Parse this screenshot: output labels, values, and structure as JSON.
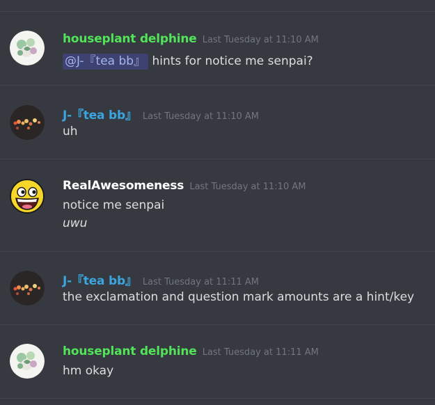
{
  "colors": {
    "background": "#36393f",
    "divider": "#42454a",
    "timestamp": "#72767d",
    "message_text": "#dcddde",
    "mention_bg": "#3e4270",
    "mention_text": "#a3b3ee"
  },
  "messages": [
    {
      "author": "houseplant delphine",
      "author_color": "#53e35a",
      "avatar": "succulent-avatar",
      "timestamp": "Last Tuesday at 11:10 AM",
      "mention": "@J-『tea bb』",
      "lines": [
        "hints for notice me senpai?"
      ]
    },
    {
      "author": "J-『tea bb』",
      "author_color": "#3aa6e0",
      "avatar": "bokeh-lights-avatar",
      "timestamp": "Last Tuesday at 11:10 AM",
      "lines": [
        "uh"
      ]
    },
    {
      "author": "RealAwesomeness",
      "author_color": "#ffffff",
      "avatar": "awesome-face-avatar",
      "timestamp": "Last Tuesday at 11:10 AM",
      "lines": [
        "notice me senpai",
        "uwu"
      ]
    },
    {
      "author": "J-『tea bb』",
      "author_color": "#3aa6e0",
      "avatar": "bokeh-lights-avatar",
      "timestamp": "Last Tuesday at 11:11 AM",
      "lines": [
        "the exclamation and question mark amounts are a hint/key"
      ]
    },
    {
      "author": "houseplant delphine",
      "author_color": "#53e35a",
      "avatar": "succulent-avatar",
      "timestamp": "Last Tuesday at 11:11 AM",
      "lines": [
        "hm okay"
      ]
    }
  ]
}
